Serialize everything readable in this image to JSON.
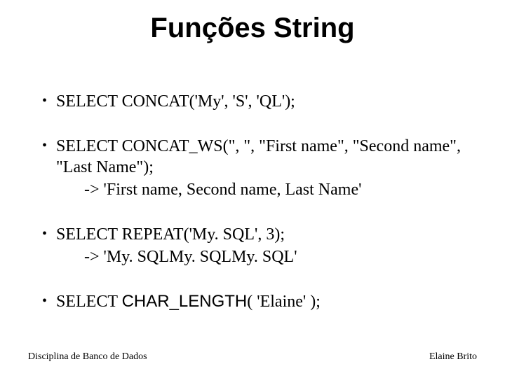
{
  "title": "Funções String",
  "bullets": [
    {
      "line": "SELECT CONCAT('My', 'S', 'QL');",
      "result": null
    },
    {
      "line": "SELECT CONCAT_WS(\", \", \"First name\", \"Second name\", \"Last Name\");",
      "result": "-> 'First name, Second name, Last Name'"
    },
    {
      "line": "SELECT REPEAT('My. SQL', 3);",
      "result": "-> 'My. SQLMy. SQLMy. SQL'"
    },
    {
      "line_prefix": "SELECT ",
      "line_func": "CHAR_LENGTH",
      "line_suffix": "( 'Elaine' );",
      "result": null
    }
  ],
  "footer": {
    "left": "Disciplina de Banco de Dados",
    "right": "Elaine Brito"
  }
}
